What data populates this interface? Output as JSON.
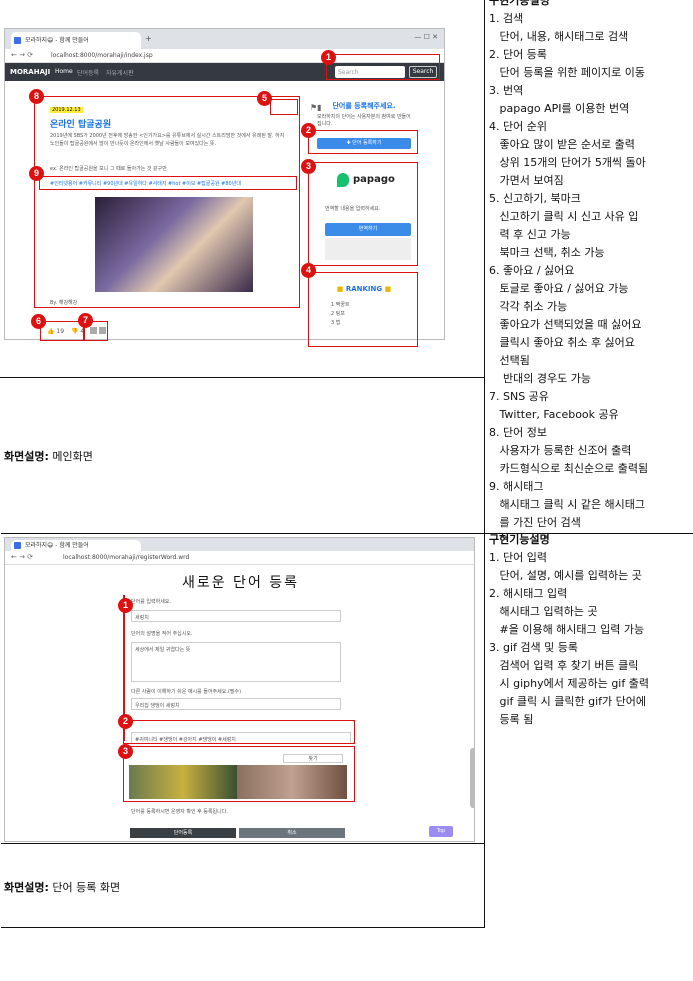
{
  "sections": [
    {
      "caption_label": "화면설명:",
      "caption_text": " 메인화면",
      "desc_title": "구현기능설명",
      "desc_lines": [
        "1. 검색",
        "   단어, 내용, 해시태그로 검색",
        "2. 단어 등록",
        "   단어 등록을 위한 페이지로 이동",
        "3. 번역",
        "   papago API를 이용한 번역",
        "4. 단어 순위",
        "   좋아요 많이 받은 순서로 출력",
        "   상위 15개의 단어가 5개씩 돌아",
        "   가면서 보여짐",
        "5. 신고하기, 북마크",
        "   신고하기 클릭 시 신고 사유 입",
        "   력 후 신고 가능",
        "   북마크 선택, 취소 가능",
        "6. 좋아요 / 싫어요",
        "   토글로 좋아요 / 싫어요 가능",
        "   각각 취소 가능",
        "   좋아요가 선택되었을 때 싫어요",
        "   클릭시 좋아요 취소 후 싫어요",
        "   선택됨",
        "    반대의 경우도 가능",
        "7. SNS 공유",
        "   Twitter, Facebook 공유",
        "8. 단어 정보",
        "   사용자가 등록한 신조어 출력",
        "   카드형식으로 최신순으로 출력됨",
        "9. 해시태그",
        "   해시태그 클릭 시 같은 해시태그",
        "   를 가진 단어 검색"
      ]
    },
    {
      "caption_label": "화면설명:",
      "caption_text": " 단어 등록 화면",
      "desc_title": "구현기능설명",
      "desc_lines": [
        "1. 단어 입력",
        "   단어, 설명, 예시를 입력하는 곳",
        "2. 해시태그 입력",
        "   해시태그 입력하는 곳",
        "   #을 이용해 해시태그 입력 가능",
        "3. gif 검색 및 등록",
        "   검색어 입력 후 찾기 버튼 클릭",
        "   시 giphy에서 제공하는 gif 출력",
        "   gif 클릭 시 클릭한 gif가 단어에",
        "   등록 됨"
      ]
    }
  ],
  "shot1": {
    "tab_title": "모라하지😄 - 함께 만들어",
    "url": "localhost:8000/morahaji/index.jsp",
    "brand": "MORAHAJI",
    "nav": [
      "Home",
      "단어등록",
      "자유게시판"
    ],
    "search_placeholder": "Search",
    "search_button": "Search",
    "login": "로그인",
    "card_date": "2019.12.13",
    "card_title": "온라인 탑골공원",
    "card_body": "2019년에 SBS가 2000년 전후에 방송한 <인기가요>를 유튜브에서 실시간 스트리밍한 것에서 유래된 말. 하지 노인들이 탑골공원에서 많이 만나듯이 온라인에서 옛날 사람들이 모여있다는 뜻.",
    "card_example": "ex. 온라인 탑골공원을 보니 그 때로 돌아가는 것 같구만",
    "hashtags": "#인터넷용어 #커뮤니티 #90년대 #유일하다 #서태지 #hot #이보 #탑골공원 #80년대",
    "by": "By. 해강해강",
    "likes": "19",
    "dislikes": "4",
    "side_register_title": "단어를 등록해주세요.",
    "side_register_text": "모라하지의 단어는 사용자분의 참여로 만들어집니다.",
    "side_register_button": "✚ 단어 등록하기",
    "papago": "papago",
    "papago_placeholder": "번역할 내용을 입력하세요.",
    "papago_button": "번역하기",
    "ranking_title": "RANKING",
    "ranking": [
      "1 짝꿍트",
      "2 팅프",
      "3 법"
    ],
    "badges": [
      "1",
      "2",
      "3",
      "4",
      "5",
      "6",
      "7",
      "8",
      "9"
    ]
  },
  "shot2": {
    "tab_title": "모라하지😄 - 함께 만들어",
    "url": "localhost:8000/morahaji/registerWord.wrd",
    "page_title": "새로운 단어 등록",
    "word_label": "단어를 입력하세요.",
    "word_value": "세렁치",
    "desc_label": "단어의 설명을 적어 주십시오.",
    "desc_value": "세상에서 제일 귀엽다는 뜻",
    "example_label": "다른 사람이 이해하기 쉬운 예시를 들어주세요.(필수)",
    "example_value": "우리집 댕댕이 세렁치",
    "hashtag_value": "#귀여니티 #댕댕이 #강아지 #댕댕이 #세렁치",
    "gif_search": "찾기",
    "gif_label": "gif 보기",
    "submit_button": "단어등록",
    "cancel_button": "취소",
    "top_button": "Top",
    "footer_text": "단어를 등록하시면 운영자 확인 후 등록됩니다.",
    "badges": [
      "1",
      "2",
      "3"
    ]
  },
  "colors": {
    "annotation": "#dd1111",
    "accent": "#3b8be8",
    "papago_green": "#17c06e",
    "navbar": "#343a40"
  }
}
